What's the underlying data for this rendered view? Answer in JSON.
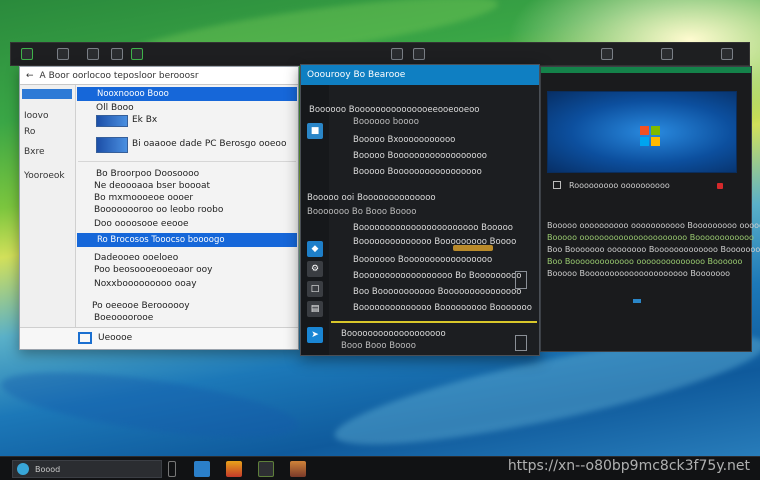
{
  "watermark": "https://xn--o80bp9mc8ck3f75y.net",
  "window_light": {
    "address": "A  Boor oorlocoo  teposloor berooosr",
    "nav": [
      "Ioovo",
      "Ro",
      "Bxre",
      "Yooroeok"
    ],
    "rows": [
      "Nooxnoooo Booo",
      "Oll Booo",
      "Ek Bx",
      "Bi oaaooe dade PC Berosgo ooeoo",
      "Bo Broorpoo Doosoooo",
      "Ne deoooaoa bser boooat",
      "Bo mxmoooeoe oooer",
      "Boooooooroo oo leobo roobo",
      "Doo oooosooe eeooe",
      "Ro Brocosos Tooocso boooogo",
      "Dadeooeo ooeloeo",
      "Poo beosoooeooeoaor ooy",
      "Noxxbooooooooo ooay",
      "Po oeeooe Beroooooy",
      "Boeoooorooe"
    ],
    "footer": "Ueoooe"
  },
  "window_dark": {
    "title": "Ooourooy Bo Bearooe",
    "lines": [
      "Boooooo   Booooooooooooooeeooeooeoo",
      "Boooooo boooo",
      "Booooo   Bxooooooooooo",
      "Booooo   Boooooooooooooooooo",
      "Booooo   Booooooooooooooooo",
      "Booooo ooi Boooooooooooooo",
      "Booooooo   Bo Booo Boooo",
      "Booooooooooooooooooooooo   Booooo",
      "Boooooooooooooo Booooooooo Boooo",
      "Booooooo Booooooooooooooooo",
      "Boooooooooooooooooo Bo Booooooooo",
      "Boo Booooooooooo Booooooooooooooo",
      "Boooooooooooooo Booooooooo Booooooo",
      "Booooooooooooooooooo",
      "Booo Booo Boooo"
    ]
  },
  "window_video": {
    "caption": "Rooooooooo oooooooooo",
    "text": [
      "Booooo oooooooooo ooooooooooo Booooooooo oooooo",
      "Booooo oooooooooooooooooooooo Boooooooooooo",
      "Boo Booooooo oooooooo Booooooooooooo Booooooo",
      "Boo Booooooooooooo oooooooooooooo Boooooo",
      "Booooo Booooooooooooooooooooo Booooooo"
    ]
  },
  "taskbar": {
    "search_text": "Boood"
  }
}
